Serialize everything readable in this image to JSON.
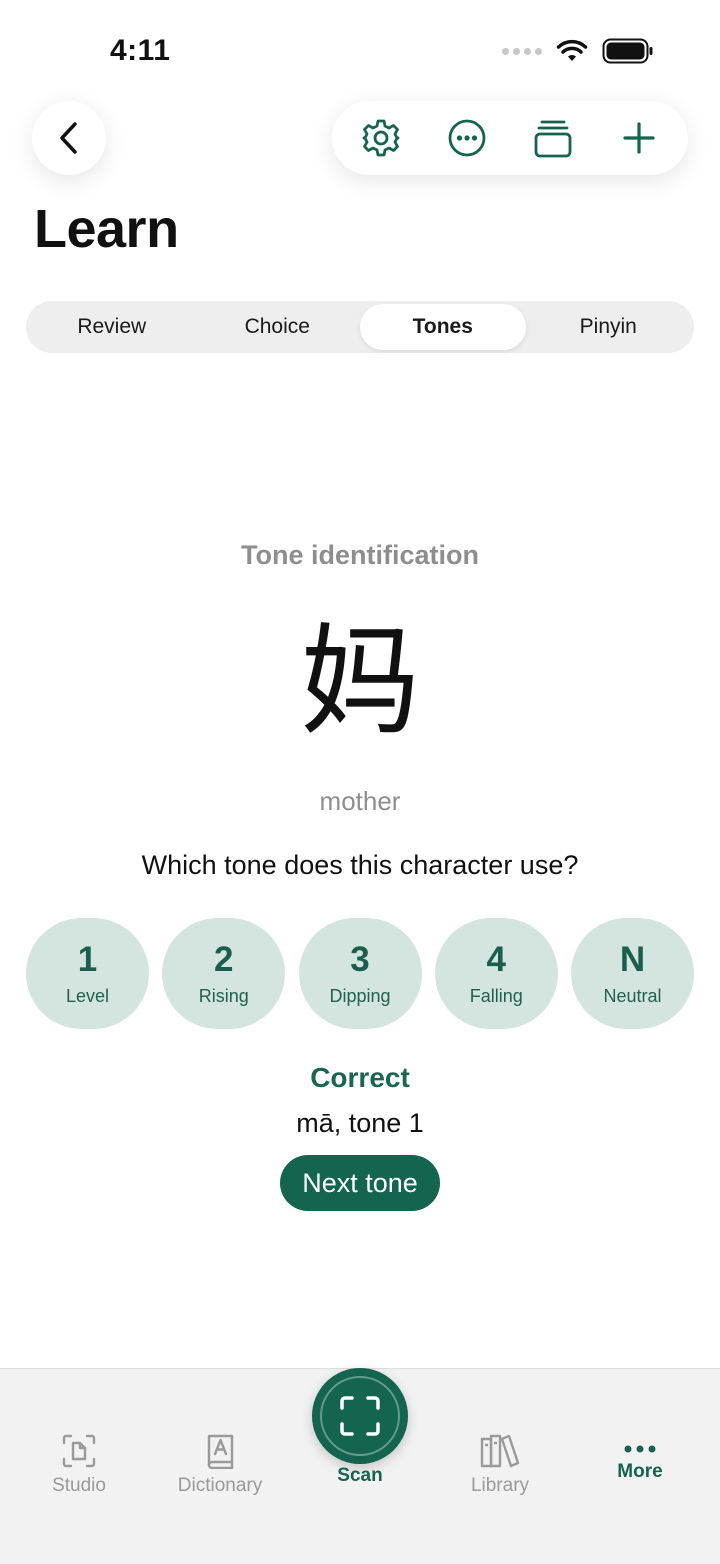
{
  "status": {
    "time": "4:11"
  },
  "header": {
    "title": "Learn"
  },
  "toolbar": {
    "icons": [
      "gear-icon",
      "ellipsis-circle-icon",
      "cards-stack-icon",
      "plus-icon"
    ]
  },
  "tabs": [
    {
      "label": "Review",
      "active": false
    },
    {
      "label": "Choice",
      "active": false
    },
    {
      "label": "Tones",
      "active": true
    },
    {
      "label": "Pinyin",
      "active": false
    }
  ],
  "quiz": {
    "subtitle": "Tone identification",
    "character": "妈",
    "meaning": "mother",
    "question": "Which tone does this character use?",
    "options": [
      {
        "num": "1",
        "name": "Level"
      },
      {
        "num": "2",
        "name": "Rising"
      },
      {
        "num": "3",
        "name": "Dipping"
      },
      {
        "num": "4",
        "name": "Falling"
      },
      {
        "num": "N",
        "name": "Neutral"
      }
    ],
    "result": "Correct",
    "answer": "mā, tone 1",
    "next_label": "Next tone"
  },
  "tabbar": {
    "studio": "Studio",
    "dictionary": "Dictionary",
    "scan": "Scan",
    "library": "Library",
    "more": "More"
  },
  "colors": {
    "accent": "#13654f",
    "tone_bg": "#d4e5df",
    "muted": "#8e8e8e"
  }
}
